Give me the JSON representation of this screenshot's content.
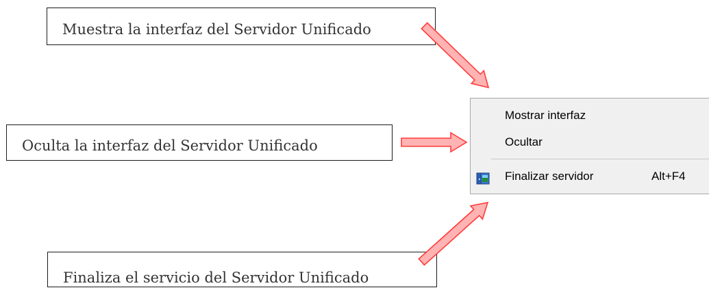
{
  "callouts": {
    "show": "Muestra la interfaz del Servidor Unificado",
    "hide": "Oculta la interfaz del Servidor Unificado",
    "quit": "Finaliza el servicio del Servidor Unificado"
  },
  "menu": {
    "items": [
      {
        "label": "Mostrar interfaz",
        "shortcut": ""
      },
      {
        "label": "Ocultar",
        "shortcut": ""
      },
      {
        "label": "Finalizar servidor",
        "shortcut": "Alt+F4",
        "icon": "exit-door-icon"
      }
    ]
  },
  "colors": {
    "arrow_fill": "#ffb3b3",
    "arrow_stroke": "#ff3b3b",
    "menu_bg": "#f0f0f0"
  }
}
